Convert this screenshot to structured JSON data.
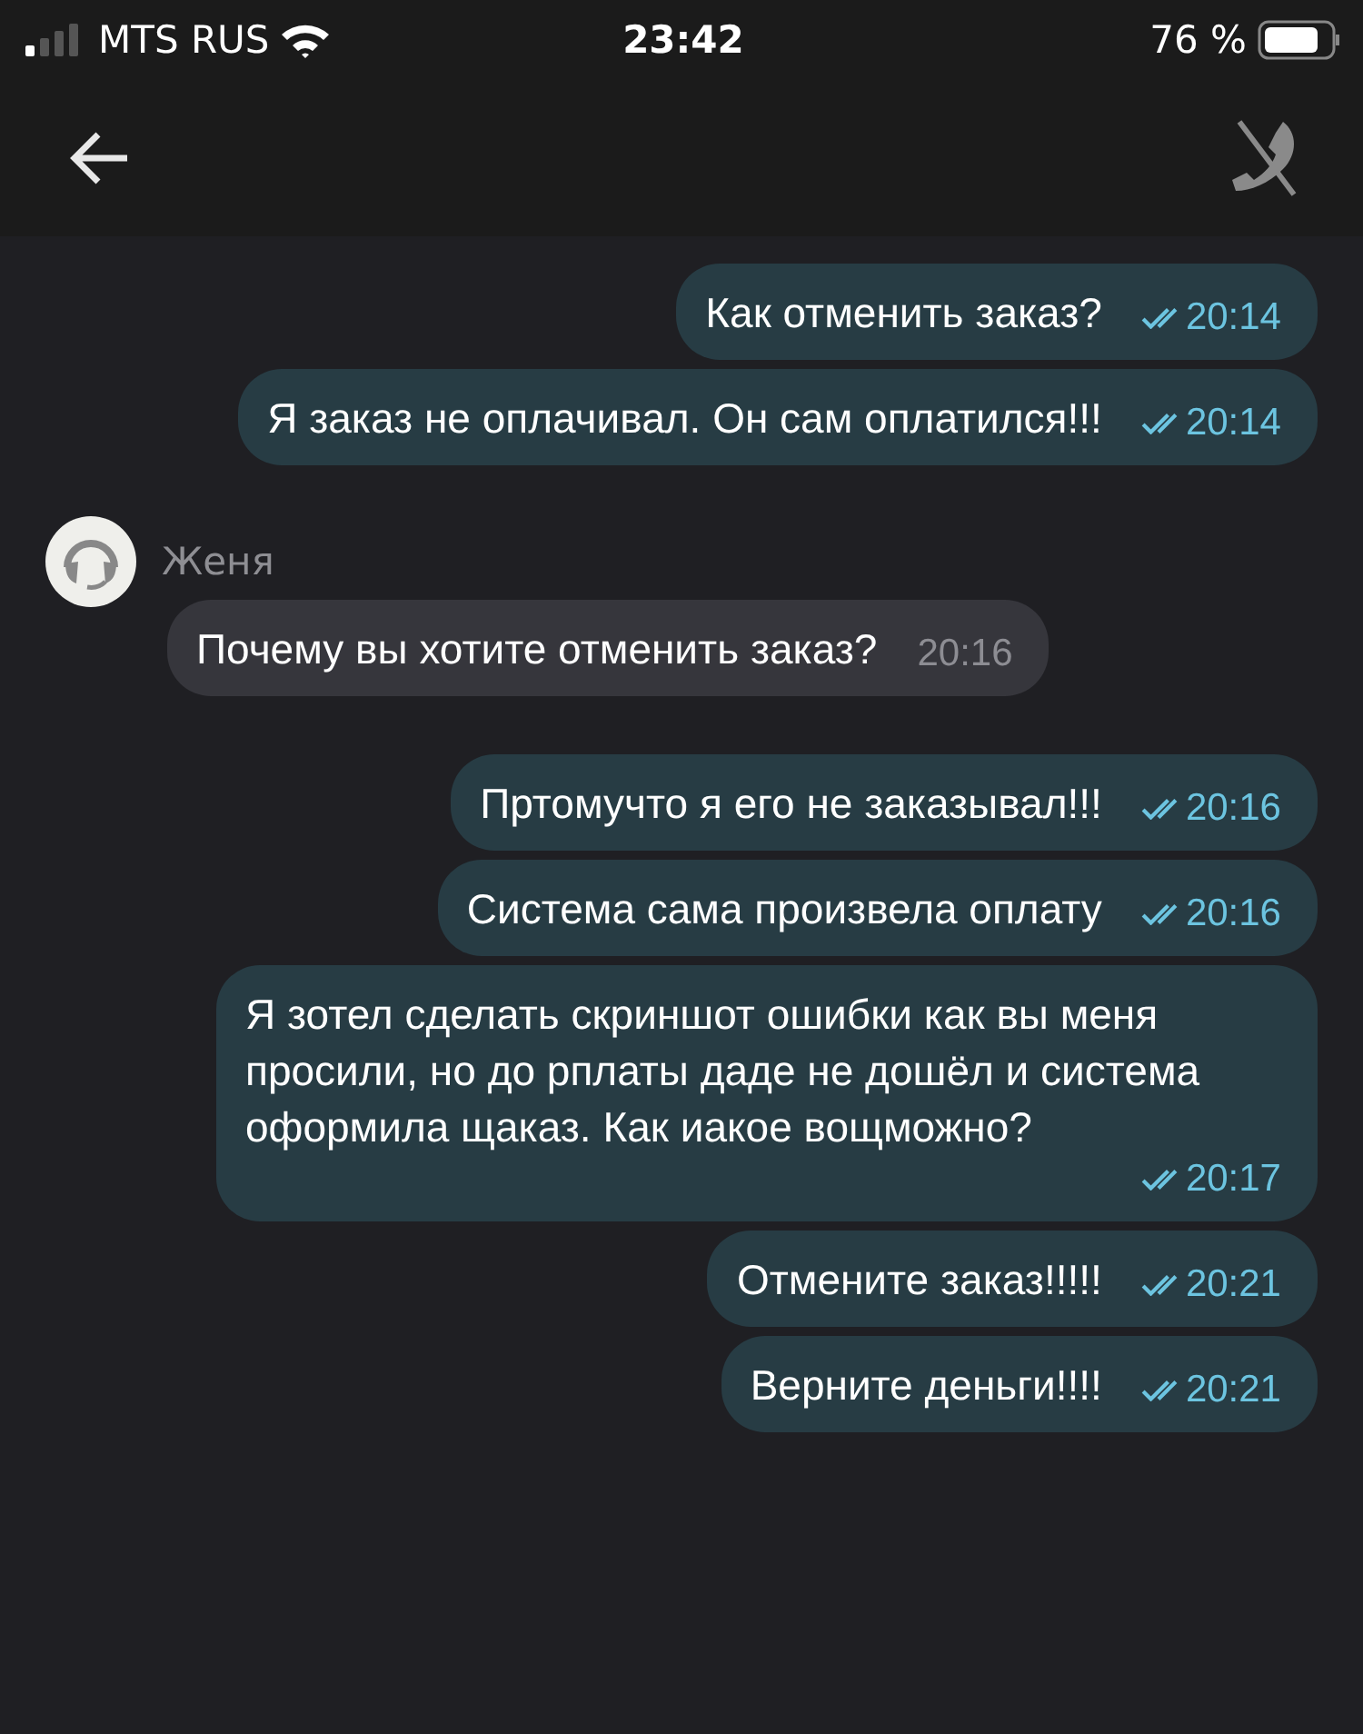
{
  "status_bar": {
    "carrier": "MTS RUS",
    "time": "23:42",
    "battery": "76 %"
  },
  "messages": [
    {
      "kind": "outgoing",
      "text": "Как отменить заказ?",
      "time": "20:14",
      "read": true
    },
    {
      "kind": "outgoing",
      "text": "Я заказ не оплачивал. Он сам оплатился!!!",
      "time": "20:14",
      "read": true
    },
    {
      "kind": "incoming",
      "sender": "Женя",
      "text": "Почему вы хотите отменить заказ?",
      "time": "20:16"
    },
    {
      "kind": "outgoing",
      "text": "Пртомучто я его не заказывал!!!",
      "time": "20:16",
      "read": true
    },
    {
      "kind": "outgoing",
      "text": "Система сама произвела оплату",
      "time": "20:16",
      "read": true
    },
    {
      "kind": "outgoing",
      "text": "Я зотел сделать скриншот ошибки как вы меня просили, но до рплаты даде не дошёл и система оформила щаказ. Как иакое вощможно?",
      "time": "20:17",
      "read": true
    },
    {
      "kind": "outgoing",
      "text": "Отмените заказ!!!!!",
      "time": "20:21",
      "read": true
    },
    {
      "kind": "outgoing",
      "text": "Верните деньги!!!!",
      "time": "20:21",
      "read": true
    }
  ]
}
